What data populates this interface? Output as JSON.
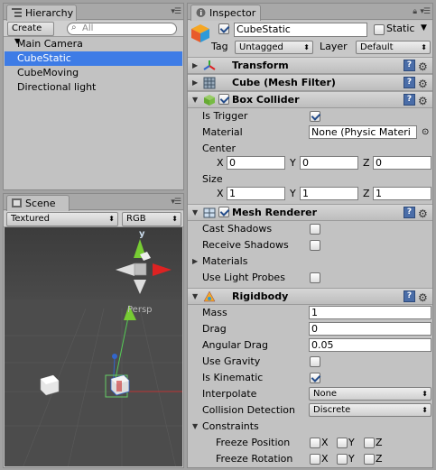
{
  "hierarchy": {
    "tab_label": "Hierarchy",
    "create_label": "Create",
    "search_placeholder": "All",
    "items": [
      "Main Camera",
      "CubeStatic",
      "CubeMoving",
      "Directional light"
    ],
    "selected_index": 1
  },
  "scene": {
    "tab_label": "Scene",
    "render_mode": "Textured",
    "color_mode": "RGB",
    "persp_label": "Persp",
    "axis_y_label": "y"
  },
  "inspector": {
    "tab_label": "Inspector",
    "object_name": "CubeStatic",
    "object_active": true,
    "static_label": "Static",
    "static_checked": false,
    "tag_label": "Tag",
    "tag_value": "Untagged",
    "layer_label": "Layer",
    "layer_value": "Default",
    "transform": {
      "title": "Transform"
    },
    "mesh_filter": {
      "title": "Cube (Mesh Filter)"
    },
    "box_collider": {
      "title": "Box Collider",
      "enabled": true,
      "is_trigger_label": "Is Trigger",
      "is_trigger": true,
      "material_label": "Material",
      "material_value": "None (Physic Materi",
      "center_label": "Center",
      "center": {
        "x": "0",
        "y": "0",
        "z": "0"
      },
      "size_label": "Size",
      "size": {
        "x": "1",
        "y": "1",
        "z": "1"
      }
    },
    "mesh_renderer": {
      "title": "Mesh Renderer",
      "enabled": true,
      "cast_shadows_label": "Cast Shadows",
      "cast_shadows": false,
      "receive_shadows_label": "Receive Shadows",
      "receive_shadows": false,
      "materials_label": "Materials",
      "use_light_probes_label": "Use Light Probes",
      "use_light_probes": false
    },
    "rigidbody": {
      "title": "Rigidbody",
      "mass_label": "Mass",
      "mass": "1",
      "drag_label": "Drag",
      "drag": "0",
      "angular_drag_label": "Angular Drag",
      "angular_drag": "0.05",
      "use_gravity_label": "Use Gravity",
      "use_gravity": false,
      "is_kinematic_label": "Is Kinematic",
      "is_kinematic": true,
      "interpolate_label": "Interpolate",
      "interpolate_value": "None",
      "collision_detection_label": "Collision Detection",
      "collision_detection_value": "Discrete",
      "constraints_label": "Constraints",
      "freeze_position_label": "Freeze Position",
      "freeze_rotation_label": "Freeze Rotation"
    },
    "axis_labels": {
      "x": "X",
      "y": "Y",
      "z": "Z"
    }
  },
  "colors": {
    "selection": "#3e7ce6",
    "panel": "#c2c2c2",
    "help_button": "#4a6da8"
  }
}
